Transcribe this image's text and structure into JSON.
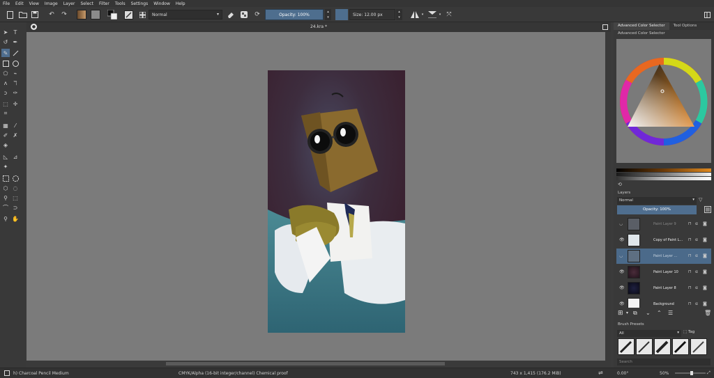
{
  "menubar": {
    "items": [
      "File",
      "Edit",
      "View",
      "Image",
      "Layer",
      "Select",
      "Filter",
      "Tools",
      "Settings",
      "Window",
      "Help"
    ]
  },
  "toolbar": {
    "blend_mode": "Normal",
    "opacity_label": "Opacity: 100%",
    "size_label": "Size: 12.00 px",
    "colors": {
      "fg_gradient_start": "#6b4a2b",
      "fg_gradient_end": "#c79a6a",
      "pattern": "#8a8a8a"
    }
  },
  "document": {
    "title": "24.kra *"
  },
  "dock": {
    "tabs": [
      "Advanced Color Selector",
      "Tool Options"
    ],
    "color_selector_title": "Advanced Color Selector",
    "layers_title": "Layers",
    "layers_blend": "Normal",
    "layers_opacity": "Opacity:  100%",
    "layers": [
      {
        "name": "Paint Layer 9",
        "visible": false,
        "selected": false
      },
      {
        "name": "Copy of Paint L...",
        "visible": true,
        "selected": false
      },
      {
        "name": "Paint Layer ...",
        "visible": false,
        "selected": true
      },
      {
        "name": "Paint Layer 10",
        "visible": true,
        "selected": false
      },
      {
        "name": "Paint Layer 8",
        "visible": true,
        "selected": false
      },
      {
        "name": "Background",
        "visible": true,
        "selected": false
      }
    ],
    "brush_presets_title": "Brush Presets",
    "brush_filter": "All",
    "tag_label": "Tag",
    "search_placeholder": "Search"
  },
  "status": {
    "brush": "h) Charcoal Pencil Medium",
    "color_model": "CMYK/Alpha (16-bit integer/channel)  Chemical proof",
    "dimensions": "743 x 1,415 (176.2 MiB)",
    "rotation": "0.00°",
    "zoom": "50%"
  },
  "colors": {
    "accent": "#4f6e8f",
    "canvas_bg": "#7b7b7b",
    "panel_bg": "#393939"
  }
}
